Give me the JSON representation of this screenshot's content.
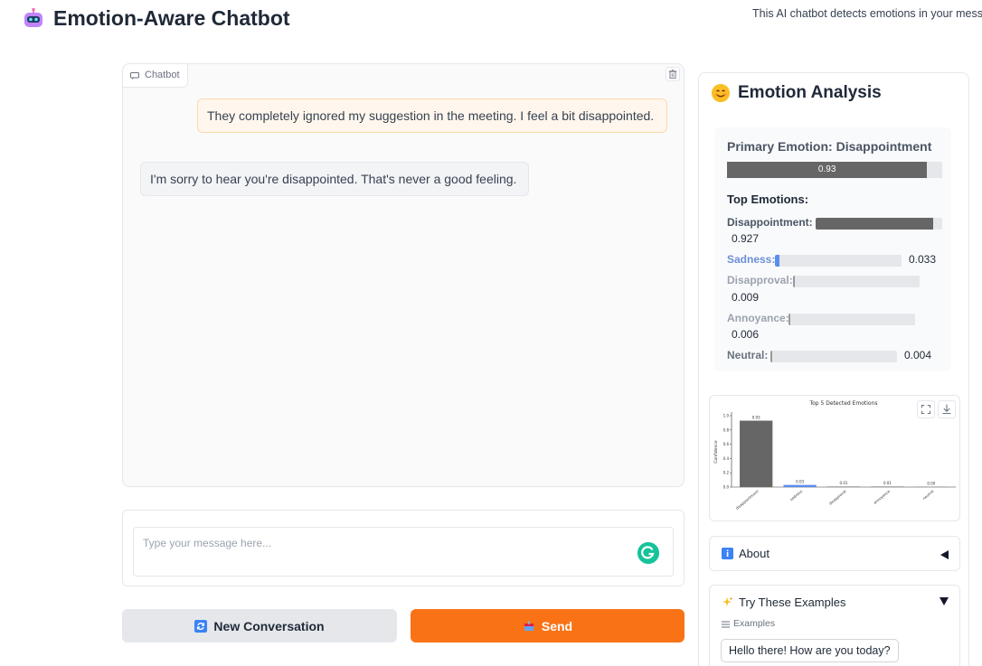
{
  "header": {
    "logo_icon": "robot-icon",
    "title": "Emotion-Aware Chatbot",
    "description": "This AI chatbot detects emotions in your messa"
  },
  "chatbot": {
    "tab_label": "Chatbot",
    "messages": [
      {
        "role": "user",
        "text": "They completely ignored my suggestion in the meeting. I feel a bit disappointed."
      },
      {
        "role": "bot",
        "text": "I'm sorry to hear you're disappointed. That's never a good feeling."
      }
    ]
  },
  "input": {
    "placeholder": "Type your message here...",
    "value": ""
  },
  "buttons": {
    "new_conversation": "New Conversation",
    "send": "Send"
  },
  "analysis": {
    "title": "Emotion Analysis",
    "primary_label": "Primary Emotion: Disappointment",
    "primary_value": 0.93,
    "primary_value_text": "0.93",
    "top_label": "Top Emotions:",
    "emotions": [
      {
        "name": "Disappointment:",
        "value": 0.927,
        "value_text": "0.927",
        "color": "#666666",
        "name_color": "#4b5563"
      },
      {
        "name": "Sadness:",
        "value": 0.033,
        "value_text": "0.033",
        "color": "#5b8def",
        "name_color": "#6b8fd6"
      },
      {
        "name": "Disapproval:",
        "value": 0.009,
        "value_text": "0.009",
        "color": "#999999",
        "name_color": "#9ca3af"
      },
      {
        "name": "Annoyance:",
        "value": 0.006,
        "value_text": "0.006",
        "color": "#999999",
        "name_color": "#9ca3af"
      },
      {
        "name": "Neutral:",
        "value": 0.004,
        "value_text": "0.004",
        "color": "#999999",
        "name_color": "#6b7280"
      }
    ]
  },
  "chart_data": {
    "type": "bar",
    "title": "Top 5 Detected Emotions",
    "xlabel": "",
    "ylabel": "Confidence",
    "ylim": [
      0,
      1.0
    ],
    "yticks": [
      "0.0",
      "0.2",
      "0.4",
      "0.6",
      "0.8",
      "1.0"
    ],
    "categories": [
      "disappointment",
      "sadness",
      "disapproval",
      "annoyance",
      "neutral"
    ],
    "values": [
      0.93,
      0.03,
      0.01,
      0.01,
      0.0
    ],
    "value_labels": [
      "0.93",
      "0.03",
      "0.01",
      "0.01",
      "0.00"
    ],
    "colors": [
      "#666666",
      "#5b8def",
      "#999999",
      "#999999",
      "#999999"
    ]
  },
  "about": {
    "label": "About",
    "icon": "info-icon"
  },
  "examples": {
    "label": "Try These Examples",
    "icon": "sparkles-icon",
    "sub_label": "Examples",
    "items": [
      "Hello there! How are you today?"
    ]
  }
}
